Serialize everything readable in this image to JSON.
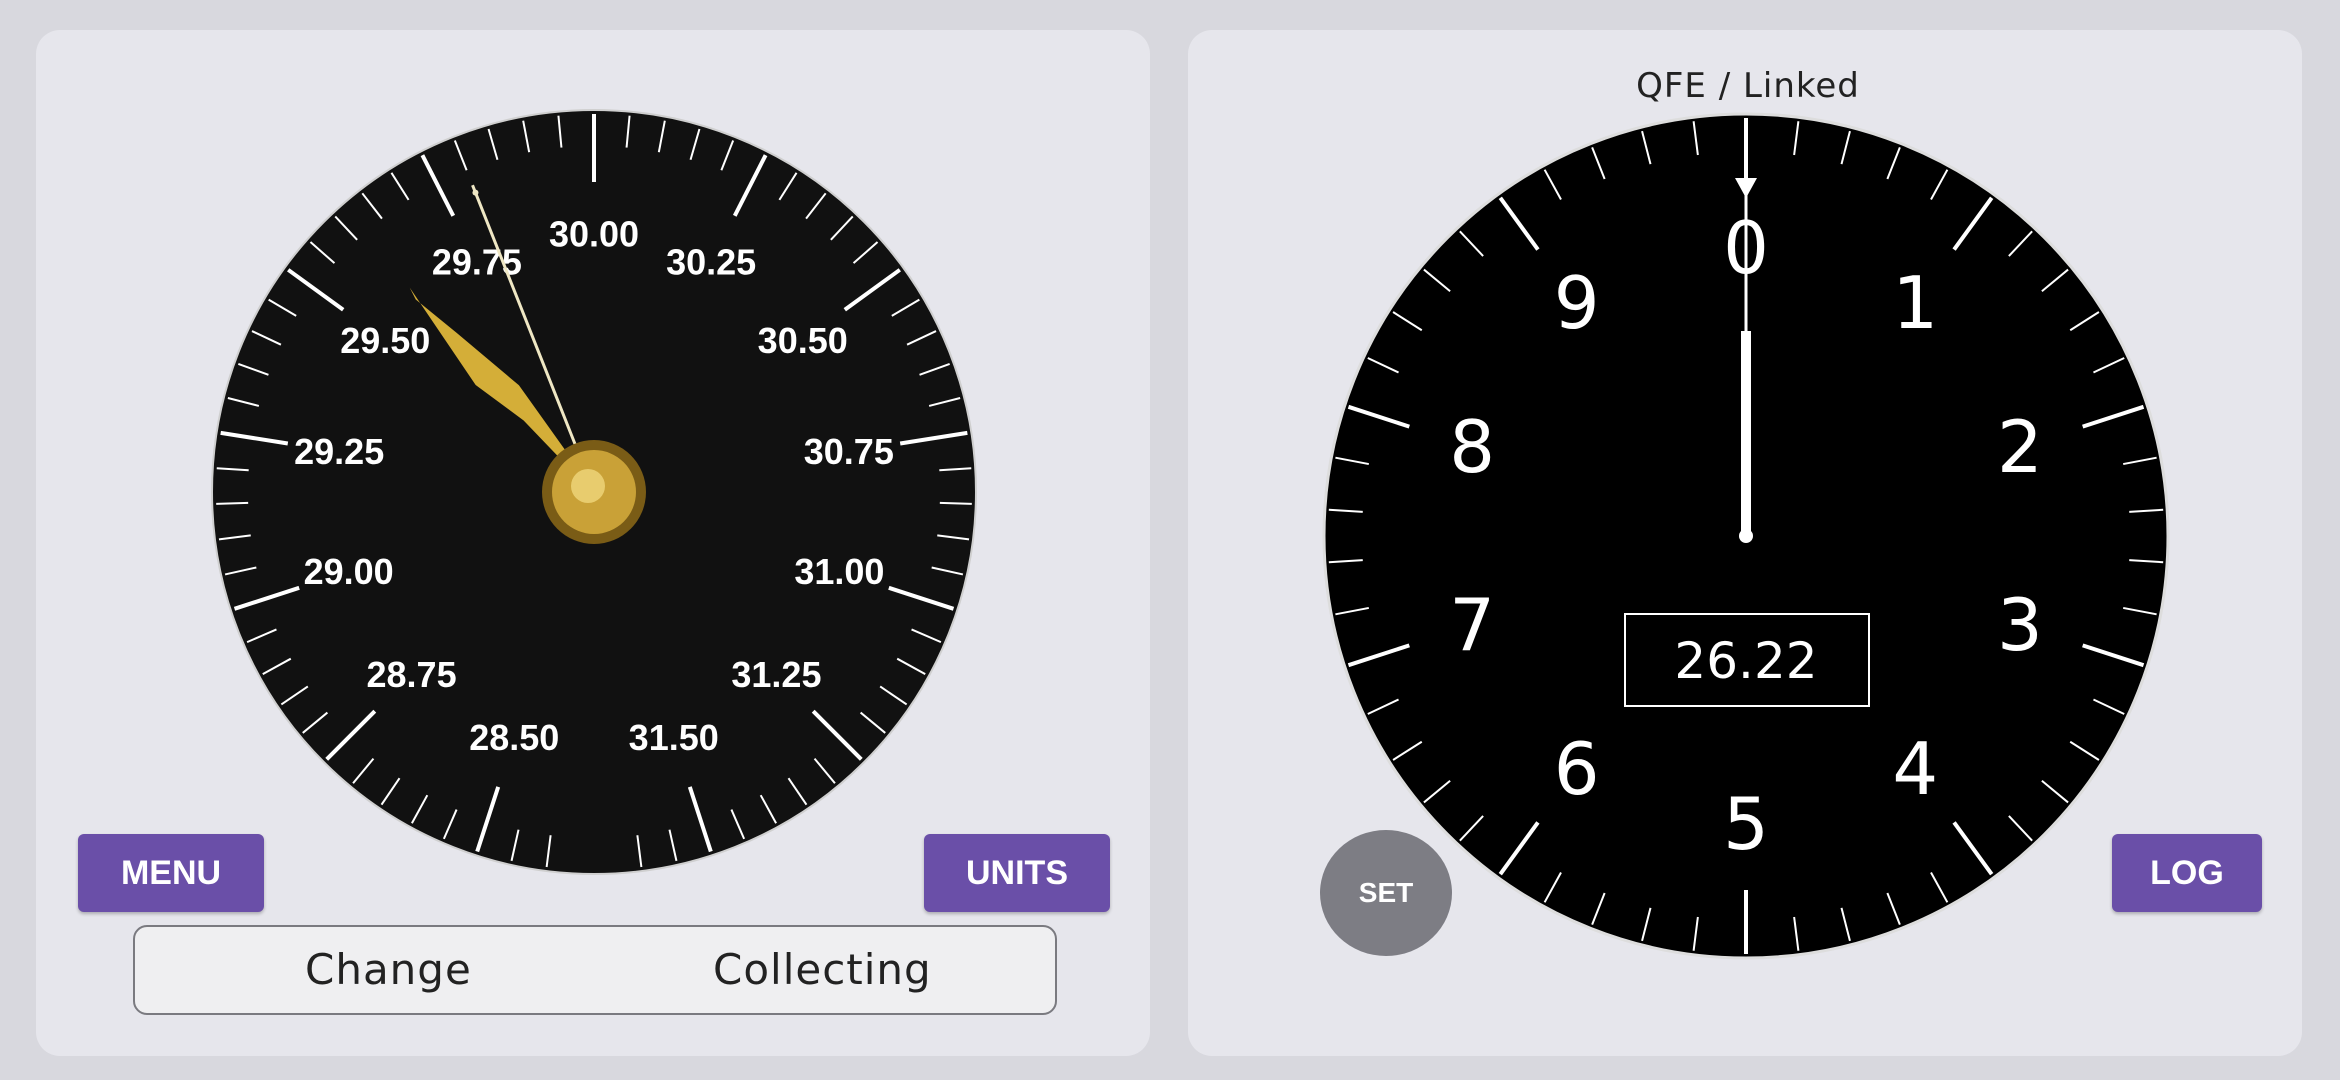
{
  "left_panel": {
    "barometer": {
      "scale_labels": [
        "28.50",
        "28.75",
        "29.00",
        "29.25",
        "29.50",
        "29.75",
        "30.00",
        "30.25",
        "30.50",
        "30.75",
        "31.00",
        "31.25",
        "31.50"
      ],
      "reference_needle_value": 29.8,
      "main_needle_value": 29.63,
      "needle_color": "#d4ae38",
      "hub_color": "#c9a137"
    },
    "menu_label": "MENU",
    "units_label": "UNITS",
    "status": {
      "left": "Change",
      "right": "Collecting"
    }
  },
  "right_panel": {
    "mode_label": "QFE / Linked",
    "altimeter": {
      "digits": [
        "0",
        "1",
        "2",
        "3",
        "4",
        "5",
        "6",
        "7",
        "8",
        "9"
      ],
      "readout": "26.22",
      "needle_value": 0
    },
    "set_label": "SET",
    "log_label": "LOG"
  },
  "colors": {
    "accent": "#6a4fa8",
    "panel": "#e6e6ec",
    "background": "#d8d8de",
    "dial_face": "#111111"
  }
}
